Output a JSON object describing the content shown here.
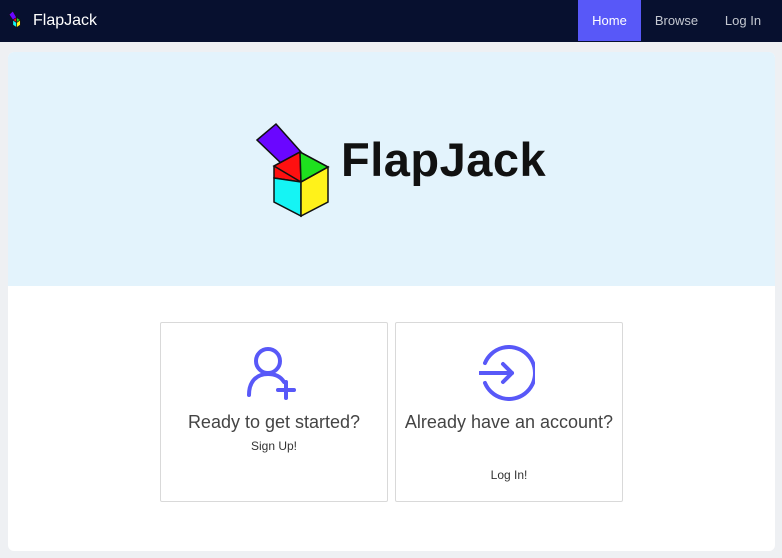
{
  "navbar": {
    "brand": {
      "name": "FlapJack",
      "icon": "flapjack-cube-logo"
    },
    "items": [
      {
        "label": "Home",
        "active": true
      },
      {
        "label": "Browse",
        "active": false
      },
      {
        "label": "Log In",
        "active": false
      }
    ]
  },
  "hero": {
    "title": "FlapJack",
    "logo_icon": "flapjack-cube-logo"
  },
  "actions": {
    "signup": {
      "heading": "Ready to get started?",
      "link": "Sign Up!",
      "icon": "user-plus-icon"
    },
    "login": {
      "heading": "Already have an account?",
      "link": "Log In!",
      "icon": "sign-in-icon"
    }
  },
  "colors": {
    "navbar_bg": "#07102f",
    "accent": "#5858f8",
    "hero_bg": "#e3f3fc",
    "page_bg": "#eef0f3",
    "cube_purple": "#6a06ff",
    "cube_red": "#ff1010",
    "cube_green": "#1ee01e",
    "cube_cyan": "#15f4f4",
    "cube_yellow": "#fff21a"
  }
}
